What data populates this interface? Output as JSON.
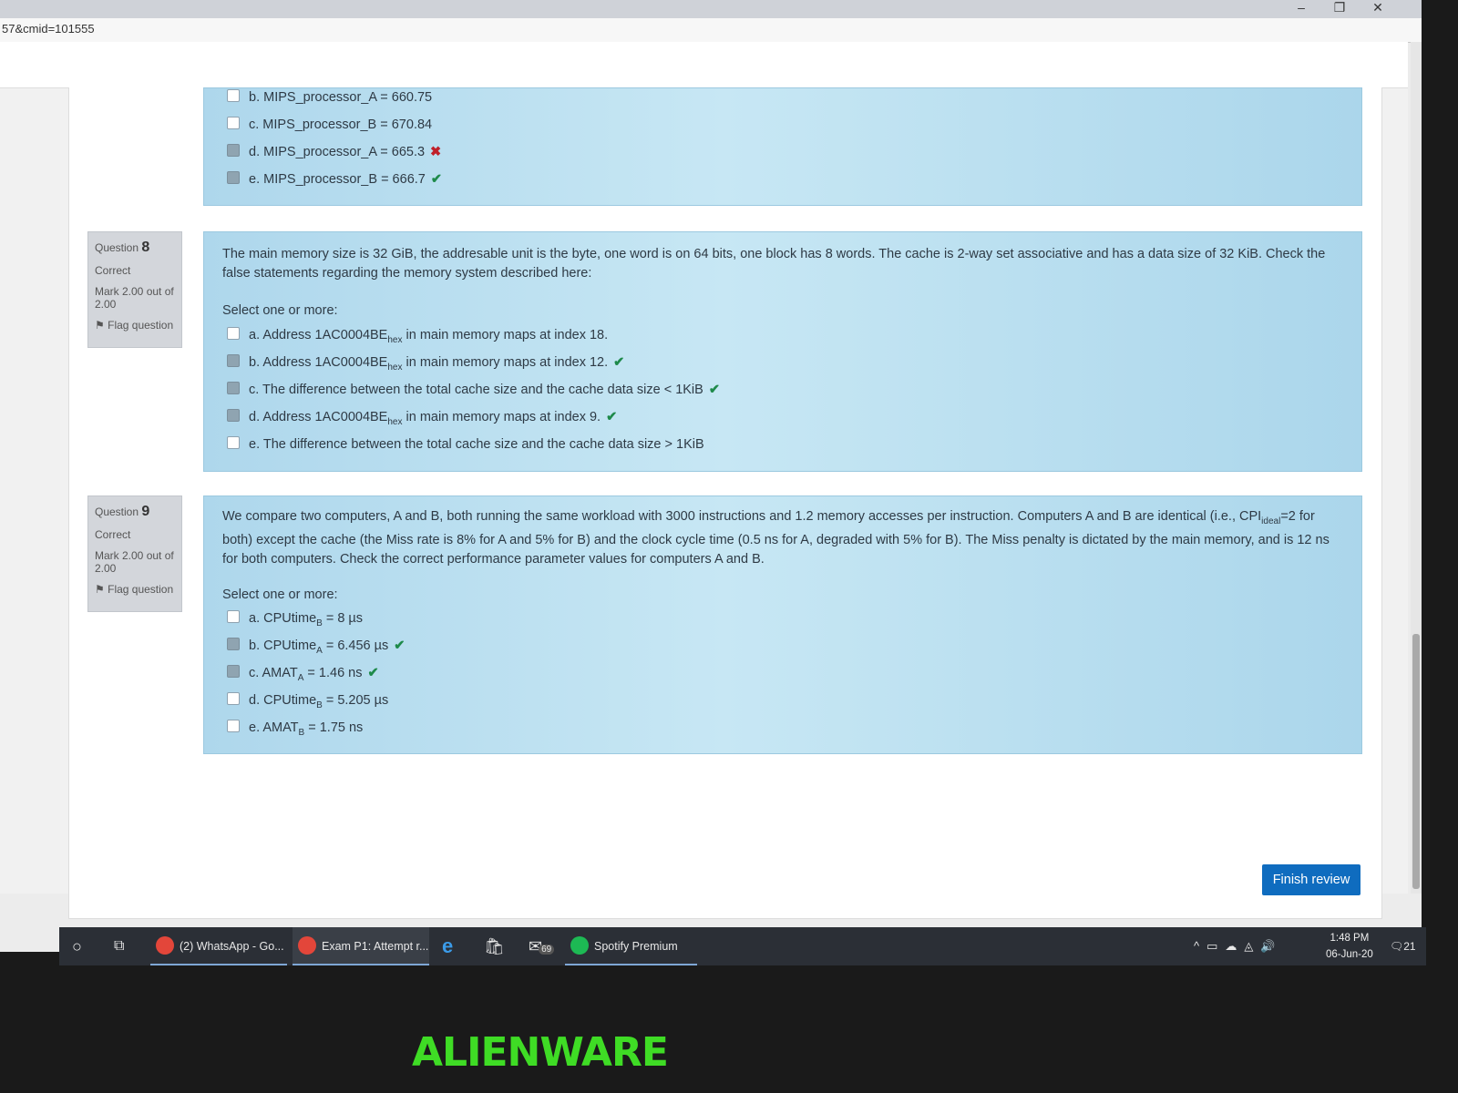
{
  "browser": {
    "url_fragment": "57&cmid=101555",
    "window_controls": {
      "minimize": "–",
      "restore": "❐",
      "close": "✕"
    }
  },
  "question7_partial": {
    "options": [
      {
        "label": "b. MIPS_processor_A = 660.75",
        "checked": false,
        "mark": ""
      },
      {
        "label": "c. MIPS_processor_B = 670.84",
        "checked": false,
        "mark": ""
      },
      {
        "label": "d. MIPS_processor_A = 665.3",
        "checked": true,
        "mark": "✖"
      },
      {
        "label": "e. MIPS_processor_B = 666.7",
        "checked": true,
        "mark": "✔"
      }
    ]
  },
  "question8": {
    "label": "Question",
    "number": "8",
    "status": "Correct",
    "mark_text": "Mark 2.00 out of 2.00",
    "flag_text": "Flag question",
    "text": "The main memory size is 32 GiB, the addresable unit is the byte, one word is on 64 bits, one block has 8 words. The cache is 2-way set associative and has a data size of 32 KiB. Check the false statements regarding the memory system described here:",
    "prompt": "Select one or more:",
    "opt_a_pre": "a. Address 1AC0004BE",
    "opt_a_sub": "hex",
    "opt_a_post": " in main memory maps at index 18.",
    "opt_b_pre": "b. Address 1AC0004BE",
    "opt_b_sub": "hex",
    "opt_b_post": " in main memory maps at index 12.",
    "opt_c": "c. The difference between the total cache size and the cache data size < 1KiB",
    "opt_d_pre": "d. Address 1AC0004BE",
    "opt_d_sub": "hex",
    "opt_d_post": " in main memory maps at index 9.",
    "opt_e": "e. The difference between the total cache size and the cache data size > 1KiB",
    "tick": "✔"
  },
  "question9": {
    "label": "Question",
    "number": "9",
    "status": "Correct",
    "mark_text": "Mark 2.00 out of 2.00",
    "flag_text": "Flag question",
    "text_1": "We compare two computers, A and B, both running the same workload with 3000 instructions and 1.2 memory accesses per instruction. Computers A and B are identical (i.e., CPI",
    "text_sub": "ideal",
    "text_2": "=2 for both) except the cache (the Miss rate  is 8% for A and 5% for B) and the clock cycle time (0.5 ns for A, degraded with 5% for B). The Miss penalty is dictated by the main memory, and is 12 ns for both computers. Check the correct performance parameter values for computers A and B.",
    "prompt": "Select one or more:",
    "opt_a_pre": "a. CPUtime",
    "opt_a_sub": "B",
    "opt_a_post": " = 8 µs",
    "opt_b_pre": "b. CPUtime",
    "opt_b_sub": "A",
    "opt_b_post": " = 6.456 µs",
    "opt_c_pre": "c. AMAT",
    "opt_c_sub": "A",
    "opt_c_post": " = 1.46 ns",
    "opt_d_pre": "d. CPUtime",
    "opt_d_sub": "B",
    "opt_d_post": " = 5.205 µs",
    "opt_e_pre": "e. AMAT",
    "opt_e_sub": "B",
    "opt_e_post": " = 1.75 ns",
    "tick": "✔"
  },
  "finish_button": "Finish review",
  "taskbar": {
    "whatsapp": "(2) WhatsApp - Go...",
    "exam": "Exam P1: Attempt r...",
    "mail_badge": "69",
    "spotify": "Spotify Premium",
    "time": "1:48 PM",
    "date": "06-Jun-20",
    "notif_count": "21"
  },
  "bezel_brand": "ALIENWARE"
}
